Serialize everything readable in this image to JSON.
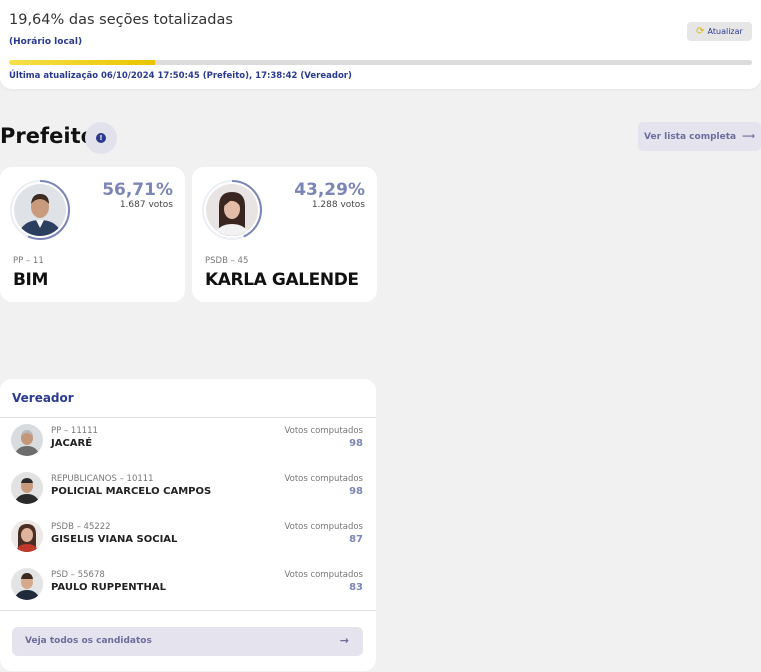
{
  "status": {
    "sections_text": "19,64% das seções totalizadas",
    "sections_fraction": 0.1964,
    "local_time": "(Horário local)",
    "refresh_label": "Atualizar",
    "last_update": "Última atualização 06/10/2024 17:50:45 (Prefeito), 17:38:42 (Vereador)"
  },
  "prefeito": {
    "title": "Prefeito",
    "list_label": "Ver lista completa",
    "candidates": [
      {
        "party": "PP – 11",
        "name": "BIM",
        "percent": "56,71%",
        "percent_value": 56.71,
        "votes": "1.687 votos"
      },
      {
        "party": "PSDB – 45",
        "name": "KARLA GALENDE",
        "percent": "43,29%",
        "percent_value": 43.29,
        "votes": "1.288 votos"
      }
    ]
  },
  "vereador": {
    "title": "Vereador",
    "votes_label": "Votos computados",
    "rows": [
      {
        "party": "PP – 11111",
        "name": "JACARÉ",
        "votes": "98"
      },
      {
        "party": "REPUBLICANOS – 10111",
        "name": "POLICIAL MARCELO CAMPOS",
        "votes": "98"
      },
      {
        "party": "PSDB – 45222",
        "name": "GISELIS VIANA SOCIAL",
        "votes": "87"
      },
      {
        "party": "PSD – 55678",
        "name": "PAULO RUPPENTHAL",
        "votes": "83"
      }
    ],
    "all_label": "Veja todos os candidatos"
  },
  "colors": {
    "accent": "#2a3a8f",
    "percent": "#7b86b5",
    "progress": "#e9c400",
    "button_bg": "#e5e3ee"
  }
}
